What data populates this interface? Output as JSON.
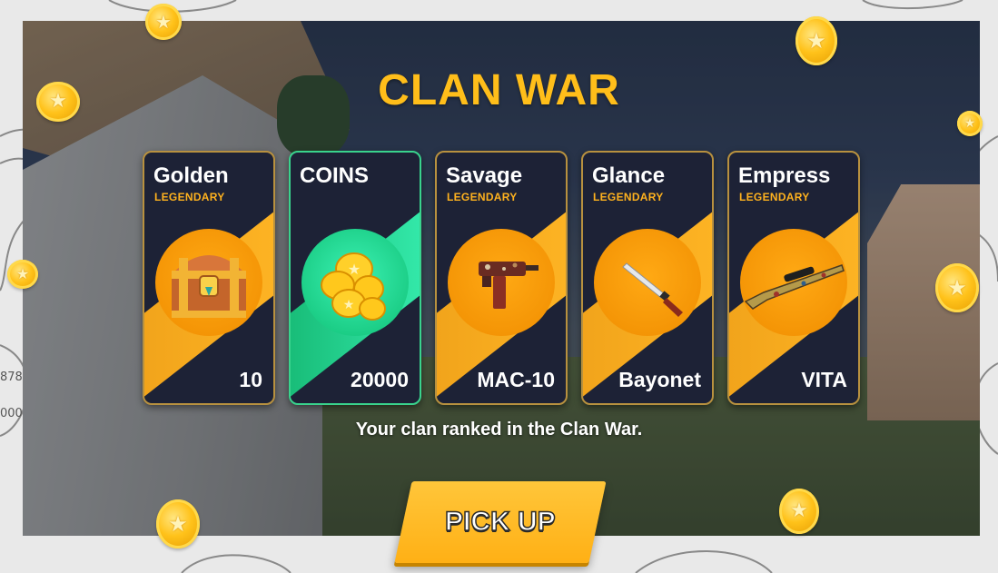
{
  "screen": {
    "title": "CLAN WAR",
    "message": "Your clan ranked in the Clan War.",
    "pickup_label": "PICK UP",
    "side_readouts": [
      "878",
      "000"
    ]
  },
  "rewards": [
    {
      "name": "Golden",
      "rarity": "LEGENDARY",
      "value": "10",
      "icon": "treasure-chest-icon"
    },
    {
      "name": "COINS",
      "rarity": "",
      "value": "20000",
      "icon": "coin-stack-icon"
    },
    {
      "name": "Savage",
      "rarity": "LEGENDARY",
      "value": "MAC-10",
      "icon": "smg-icon"
    },
    {
      "name": "Glance",
      "rarity": "LEGENDARY",
      "value": "Bayonet",
      "icon": "knife-icon"
    },
    {
      "name": "Empress",
      "rarity": "LEGENDARY",
      "value": "VITA",
      "icon": "sniper-rifle-icon"
    }
  ],
  "colors": {
    "title": "#ffbe1a",
    "card_bg": "#1d2236",
    "legendary_band": "#ffb625",
    "coins_band": "#38f0b2",
    "button": "#ffb015"
  }
}
